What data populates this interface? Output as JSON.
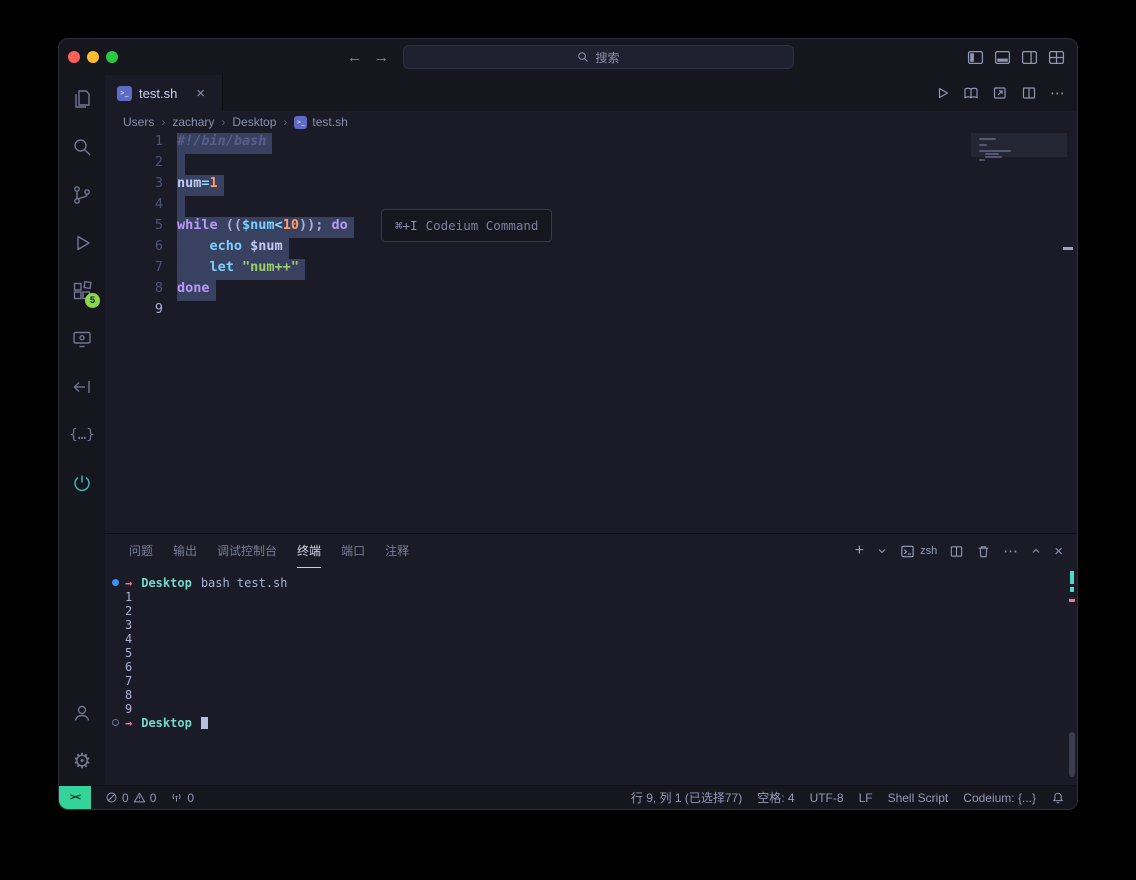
{
  "colors": {
    "editor-bg": "#1a1b26",
    "chrome-bg": "#16161e",
    "selection": "#384160",
    "line-number": "#4c5478",
    "comment": "#565f89",
    "keyword": "#bb9af7",
    "builtin": "#7dcfff",
    "variable": "#c0caf5",
    "number": "#ff9e64",
    "string": "#9ece6a",
    "operator": "#89ddff",
    "cwd-teal": "#73daca",
    "arrow-red": "#f7768e",
    "deco-blue": "#3794ff",
    "remote-green": "#34d399",
    "badge-green": "#8bd84f",
    "traffic-close": "#ff5f57",
    "traffic-min": "#febc2e",
    "traffic-zoom": "#28c840"
  },
  "titlebar": {
    "search_placeholder": "搜索"
  },
  "activitybar": {
    "extensions_badge": "5"
  },
  "tabbar": {
    "tabs": [
      {
        "label": "test.sh",
        "icon": "shell-file-icon",
        "active": true
      }
    ]
  },
  "breadcrumb": {
    "items": [
      {
        "label": "Users"
      },
      {
        "label": "zachary"
      },
      {
        "label": "Desktop"
      },
      {
        "label": "test.sh",
        "icon": "shell-file-icon"
      }
    ]
  },
  "editor": {
    "hint": {
      "shortcut": "⌘+I",
      "label": "Codeium Command"
    },
    "lines": [
      {
        "n": "1",
        "selected": true,
        "tokens": [
          {
            "t": "#!/bin/bash",
            "c": "comment"
          }
        ]
      },
      {
        "n": "2",
        "selected": true,
        "tokens": []
      },
      {
        "n": "3",
        "selected": true,
        "tokens": [
          {
            "t": "num",
            "c": "variable"
          },
          {
            "t": "=",
            "c": "operator"
          },
          {
            "t": "1",
            "c": "number"
          }
        ]
      },
      {
        "n": "4",
        "selected": true,
        "tokens": []
      },
      {
        "n": "5",
        "selected": true,
        "tokens": [
          {
            "t": "while",
            "c": "keyword"
          },
          {
            "t": " ",
            "c": "plain"
          },
          {
            "t": "((",
            "c": "plain"
          },
          {
            "t": "$num",
            "c": "builtin"
          },
          {
            "t": "<",
            "c": "operator"
          },
          {
            "t": "10",
            "c": "number"
          },
          {
            "t": "))",
            "c": "plain"
          },
          {
            "t": "; ",
            "c": "plain"
          },
          {
            "t": "do",
            "c": "keyword"
          }
        ]
      },
      {
        "n": "6",
        "selected": true,
        "tokens": [
          {
            "t": "····",
            "c": "ws"
          },
          {
            "t": "echo",
            "c": "builtin"
          },
          {
            "t": " ",
            "c": "plain"
          },
          {
            "t": "$num",
            "c": "variable"
          }
        ]
      },
      {
        "n": "7",
        "selected": true,
        "tokens": [
          {
            "t": "····",
            "c": "ws"
          },
          {
            "t": "let",
            "c": "builtin"
          },
          {
            "t": " ",
            "c": "plain"
          },
          {
            "t": "\"num++\"",
            "c": "string"
          }
        ]
      },
      {
        "n": "8",
        "selected": true,
        "tokens": [
          {
            "t": "done",
            "c": "keyword"
          }
        ]
      },
      {
        "n": "9",
        "selected": false,
        "active": true,
        "tokens": []
      }
    ]
  },
  "panel": {
    "tabs": [
      {
        "name": "problems",
        "label": "问题"
      },
      {
        "name": "output",
        "label": "输出"
      },
      {
        "name": "debug-console",
        "label": "调试控制台"
      },
      {
        "name": "terminal",
        "label": "终端",
        "active": true
      },
      {
        "name": "ports",
        "label": "端口"
      },
      {
        "name": "comments",
        "label": "注释"
      }
    ],
    "actions": {
      "new_terminal": "+",
      "shell_label": "zsh"
    }
  },
  "terminal": {
    "lines": [
      {
        "deco": "run",
        "arrow": "→",
        "cwd": "Desktop",
        "text": "bash test.sh"
      },
      {
        "text": "1"
      },
      {
        "text": "2"
      },
      {
        "text": "3"
      },
      {
        "text": "4"
      },
      {
        "text": "5"
      },
      {
        "text": "6"
      },
      {
        "text": "7"
      },
      {
        "text": "8"
      },
      {
        "text": "9"
      },
      {
        "deco": "prompt",
        "arrow": "→",
        "cwd": "Desktop",
        "cursor": true
      }
    ]
  },
  "statusbar": {
    "remote_glyph": "><",
    "errors": "0",
    "warnings": "0",
    "broadcast": "0",
    "cursor_position": "行 9, 列 1 (已选择77)",
    "indent": "空格: 4",
    "encoding": "UTF-8",
    "eol": "LF",
    "language": "Shell Script",
    "codeium": "Codeium: {...}"
  }
}
